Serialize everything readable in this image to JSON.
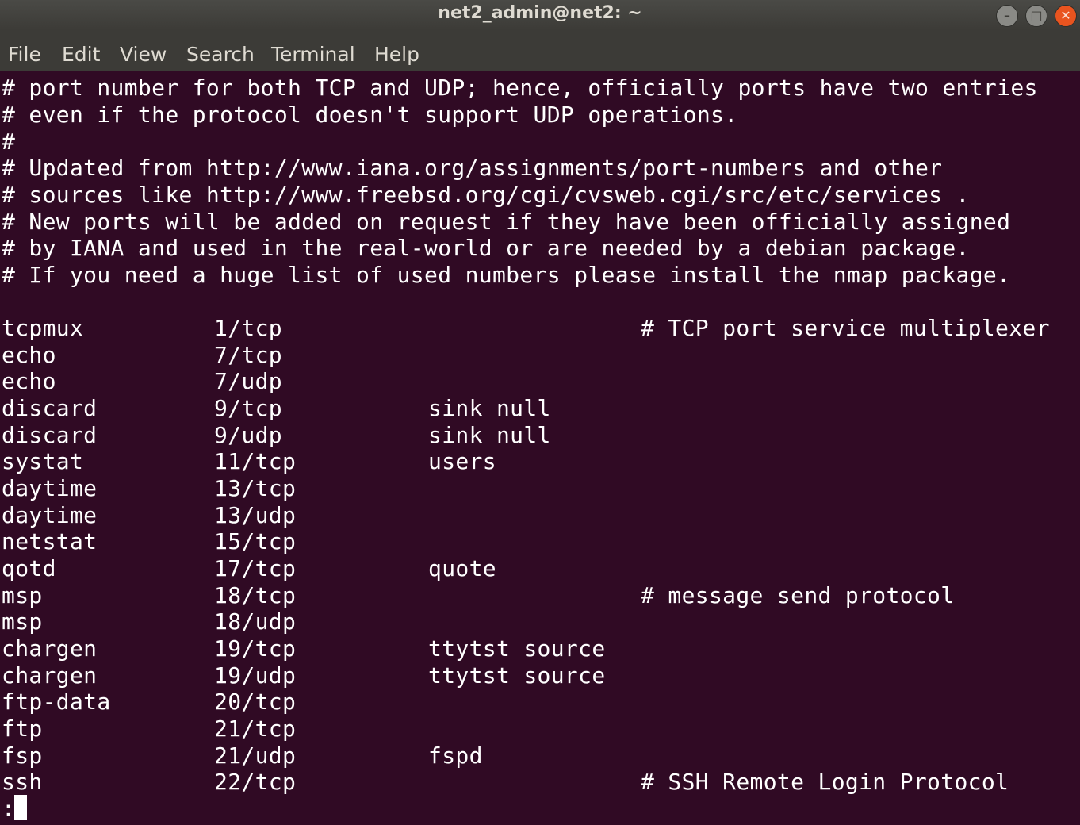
{
  "window": {
    "title": "net2_admin@net2: ~"
  },
  "window_controls": {
    "minimize_glyph": "–",
    "maximize_glyph": "□",
    "close_glyph": "✕"
  },
  "menu": [
    "File",
    "Edit",
    "View",
    "Search",
    "Terminal",
    "Help"
  ],
  "comments": [
    "# port number for both TCP and UDP; hence, officially ports have two entries",
    "# even if the protocol doesn't support UDP operations.",
    "#",
    "# Updated from http://www.iana.org/assignments/port-numbers and other",
    "# sources like http://www.freebsd.org/cgi/cvsweb.cgi/src/etc/services .",
    "# New ports will be added on request if they have been officially assigned",
    "# by IANA and used in the real-world or are needed by a debian package.",
    "# If you need a huge list of used numbers please install the nmap package."
  ],
  "services": [
    {
      "name": "tcpmux",
      "port": "1/tcp",
      "aliases": "",
      "comment": "# TCP port service multiplexer"
    },
    {
      "name": "echo",
      "port": "7/tcp",
      "aliases": "",
      "comment": ""
    },
    {
      "name": "echo",
      "port": "7/udp",
      "aliases": "",
      "comment": ""
    },
    {
      "name": "discard",
      "port": "9/tcp",
      "aliases": "sink null",
      "comment": ""
    },
    {
      "name": "discard",
      "port": "9/udp",
      "aliases": "sink null",
      "comment": ""
    },
    {
      "name": "systat",
      "port": "11/tcp",
      "aliases": "users",
      "comment": ""
    },
    {
      "name": "daytime",
      "port": "13/tcp",
      "aliases": "",
      "comment": ""
    },
    {
      "name": "daytime",
      "port": "13/udp",
      "aliases": "",
      "comment": ""
    },
    {
      "name": "netstat",
      "port": "15/tcp",
      "aliases": "",
      "comment": ""
    },
    {
      "name": "qotd",
      "port": "17/tcp",
      "aliases": "quote",
      "comment": ""
    },
    {
      "name": "msp",
      "port": "18/tcp",
      "aliases": "",
      "comment": "# message send protocol"
    },
    {
      "name": "msp",
      "port": "18/udp",
      "aliases": "",
      "comment": ""
    },
    {
      "name": "chargen",
      "port": "19/tcp",
      "aliases": "ttytst source",
      "comment": ""
    },
    {
      "name": "chargen",
      "port": "19/udp",
      "aliases": "ttytst source",
      "comment": ""
    },
    {
      "name": "ftp-data",
      "port": "20/tcp",
      "aliases": "",
      "comment": ""
    },
    {
      "name": "ftp",
      "port": "21/tcp",
      "aliases": "",
      "comment": ""
    },
    {
      "name": "fsp",
      "port": "21/udp",
      "aliases": "fspd",
      "comment": ""
    },
    {
      "name": "ssh",
      "port": "22/tcp",
      "aliases": "",
      "comment": "# SSH Remote Login Protocol"
    }
  ],
  "prompt": ":",
  "colors": {
    "terminal_background": "#300a24",
    "terminal_text": "#ffffff",
    "titlebar": "#3c3b37",
    "title_text": "#dfdbd2",
    "close_button": "#e9541f"
  }
}
